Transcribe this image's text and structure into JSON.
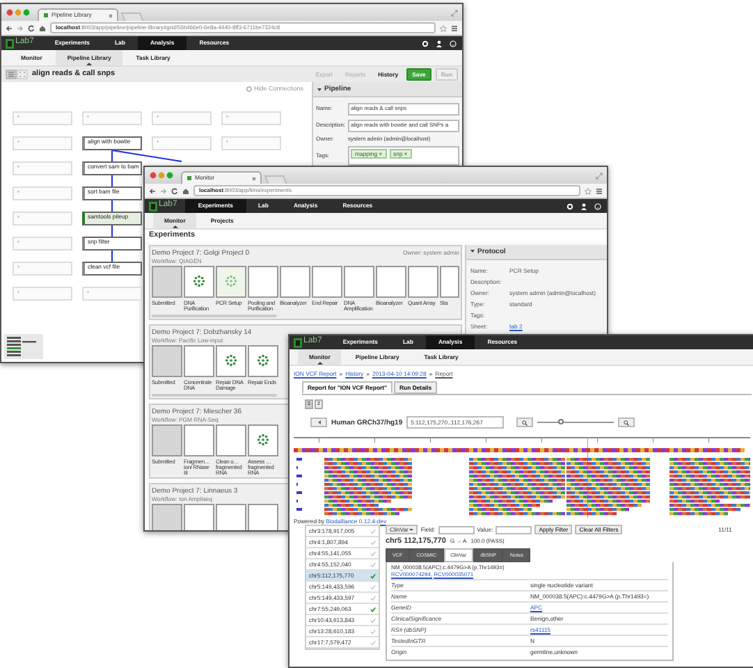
{
  "pipeline_window": {
    "browser_tab": "Pipeline Library",
    "url": "**localhost**:8003/app/pipeline/pipeline-library#grid/55b466e0-6e8a-4440-8ff3-6711be7324c8",
    "logo": "Lab7",
    "nav": [
      {
        "label": "Experiments",
        "selected": false
      },
      {
        "label": "Lab",
        "selected": false
      },
      {
        "label": "Analysis",
        "selected": true
      },
      {
        "label": "Resources",
        "selected": false
      }
    ],
    "subnav": [
      {
        "label": "Monitor",
        "selected": false
      },
      {
        "label": "Pipeline Library",
        "selected": true
      },
      {
        "label": "Task Library",
        "selected": false
      }
    ],
    "title": "align reads & call snps",
    "actions": [
      {
        "label": "Export",
        "kind": "link",
        "disabled": true
      },
      {
        "label": "Reports",
        "kind": "link",
        "disabled": true
      },
      {
        "label": "History",
        "kind": "link",
        "disabled": false
      },
      {
        "label": "Save",
        "kind": "button",
        "disabled": false
      },
      {
        "label": "Run",
        "kind": "button",
        "disabled": true
      }
    ],
    "hide_connections": "Hide Connections",
    "grid_rows": [
      [
        {
          "label": "+",
          "kind": "slot"
        },
        {
          "label": "+",
          "kind": "slot"
        },
        {
          "label": "+",
          "kind": "slot"
        },
        {
          "label": "+",
          "kind": "slot"
        }
      ],
      [
        {
          "label": "+",
          "kind": "slot"
        },
        {
          "label": "align with bowtie",
          "kind": "task",
          "selected": false,
          "connects_down": true,
          "connects_down_right": true
        },
        {
          "label": "+",
          "kind": "slot"
        },
        {
          "label": "+",
          "kind": "slot"
        }
      ],
      [
        {
          "label": "+",
          "kind": "slot"
        },
        {
          "label": "convert sam to bam",
          "kind": "task",
          "selected": false,
          "connects_down": true,
          "connects_down_right": false
        }
      ],
      [
        {
          "label": "+",
          "kind": "slot"
        },
        {
          "label": "sort bam file",
          "kind": "task",
          "selected": false,
          "connects_down": true,
          "connects_down_right": false
        }
      ],
      [
        {
          "label": "+",
          "kind": "slot"
        },
        {
          "label": "samtools pileup",
          "kind": "task",
          "selected": true,
          "connects_down": true,
          "connects_down_right": false
        }
      ],
      [
        {
          "label": "+",
          "kind": "slot"
        },
        {
          "label": "snp filter",
          "kind": "task",
          "selected": false,
          "connects_down": true,
          "connects_down_right": false
        }
      ],
      [
        {
          "label": "+",
          "kind": "slot"
        },
        {
          "label": "clean vcf file",
          "kind": "task",
          "selected": false,
          "connects_down": false,
          "connects_down_right": false
        }
      ],
      [
        {
          "label": "+",
          "kind": "slot"
        },
        {
          "label": "+",
          "kind": "slot"
        }
      ]
    ],
    "panel": {
      "title": "Pipeline",
      "fields": [
        {
          "label": "Name:",
          "value": "align reads & call snps",
          "kind": "input"
        },
        {
          "label": "Description:",
          "value": "align reads with bowtie and call SNPs a",
          "kind": "input"
        },
        {
          "label": "Owner:",
          "value": "system admin (admin@localhost)",
          "kind": "text"
        },
        {
          "label": "Tags:",
          "tags": [
            {
              "label": "mapping",
              "remove": "×"
            },
            {
              "label": "snp",
              "remove": "×"
            }
          ],
          "kind": "tags"
        }
      ]
    }
  },
  "monitor_window": {
    "browser_tab": "Monitor",
    "url": "**localhost**:8003/app/lims/experiments",
    "logo": "Lab7",
    "nav": [
      {
        "label": "Experiments",
        "selected": true
      },
      {
        "label": "Lab",
        "selected": false
      },
      {
        "label": "Analysis",
        "selected": false
      },
      {
        "label": "Resources",
        "selected": false
      }
    ],
    "subnav": [
      {
        "label": "Monitor",
        "selected": true
      },
      {
        "label": "Projects",
        "selected": false
      }
    ],
    "heading": "Experiments",
    "projects": [
      {
        "name": "Demo Project 7: Golgi Project 0",
        "workflow": "Workflow: QIAGEN",
        "owner": "Owner: system admin",
        "steps": [
          {
            "label": "Submitted",
            "kind": "submitted",
            "selected": false
          },
          {
            "label": "DNA Purification",
            "kind": "samples",
            "selected": false
          },
          {
            "label": "PCR Setup",
            "kind": "samples",
            "selected": true
          },
          {
            "label": "Pooling and Purification",
            "kind": "empty",
            "selected": false
          },
          {
            "label": "Bioanalyzer",
            "kind": "empty",
            "selected": false
          },
          {
            "label": "End Repair",
            "kind": "empty",
            "selected": false
          },
          {
            "label": "DNA Amplification",
            "kind": "empty",
            "selected": false
          },
          {
            "label": "Bioanalyzer",
            "kind": "empty",
            "selected": false
          },
          {
            "label": "Quant Array",
            "kind": "empty",
            "selected": false
          },
          {
            "label": "Sta",
            "kind": "empty",
            "selected": false
          }
        ]
      },
      {
        "name": "Demo Project 7: Dobzhansky 14",
        "workflow": "Workflow: Pacific Low-input",
        "steps": [
          {
            "label": "Submitted",
            "kind": "submitted",
            "selected": false
          },
          {
            "label": "Concentrate DNA",
            "kind": "empty",
            "selected": false
          },
          {
            "label": "Repair DNA Damage",
            "kind": "samples",
            "selected": false
          },
          {
            "label": "Repair Ends",
            "kind": "samples",
            "selected": false
          }
        ]
      },
      {
        "name": "Demo Project 7: Miescher 36",
        "workflow": "Workflow: PGM RNA-Seq",
        "steps": [
          {
            "label": "Submitted",
            "kind": "submitted",
            "selected": false
          },
          {
            "label": "Fragmen…ion/ RNase III",
            "kind": "empty",
            "selected": false
          },
          {
            "label": "Clean u… fragmented RNA",
            "kind": "empty",
            "selected": false
          },
          {
            "label": "Assess … fragmented RNA",
            "kind": "samples",
            "selected": false
          }
        ]
      },
      {
        "name": "Demo Project 7: Linnaeus 3",
        "workflow": "Workflow: Ion Ampliseq",
        "steps": [
          {
            "kind": "submitted",
            "selected": false
          },
          {
            "kind": "empty",
            "selected": false
          },
          {
            "kind": "empty",
            "selected": false
          },
          {
            "kind": "empty",
            "selected": false
          }
        ]
      }
    ],
    "panel": {
      "title": "Protocol",
      "fields": [
        {
          "label": "Name:",
          "value": "PCR Setup",
          "kind": "text"
        },
        {
          "label": "Description:",
          "kind": "text"
        },
        {
          "label": "Owner:",
          "value": "system admin (admin@localhost)",
          "kind": "text"
        },
        {
          "label": "Type:",
          "value": "standard",
          "kind": "text"
        },
        {
          "label": "Tags:",
          "kind": "text"
        },
        {
          "label": "Sheet:",
          "value": "tab 2",
          "kind": "link"
        }
      ]
    }
  },
  "report_window": {
    "logo": "Lab7",
    "nav": [
      {
        "label": "Experiments",
        "selected": false
      },
      {
        "label": "Lab",
        "selected": false
      },
      {
        "label": "Analysis",
        "selected": true
      },
      {
        "label": "Resources",
        "selected": false
      }
    ],
    "subnav": [
      {
        "label": "Monitor",
        "selected": true
      },
      {
        "label": "Pipeline Library",
        "selected": false
      },
      {
        "label": "Task Library",
        "selected": false
      }
    ],
    "breadcrumb": {
      "separator": "»",
      "items": [
        "ION VCF Report",
        "History",
        "2013-04-10 14:09:28",
        "Report"
      ]
    },
    "tabs": [
      {
        "label": "Report for \"ION VCF Report\"",
        "selected": true
      },
      {
        "label": "Run Details",
        "selected": false
      }
    ],
    "pages": [
      {
        "label": "1",
        "selected": true
      },
      {
        "label": "2",
        "selected": false
      }
    ],
    "genome": "Human GRCh37/hg19",
    "location": "5:112,175,270..112,176,267",
    "zoom": {
      "level": 0.3
    },
    "powered_by": {
      "text": "Powered by",
      "link": "Biodalliance 0.12.4-dev"
    },
    "count": "11/11",
    "variants": [
      {
        "label": "chr3:178,917,005",
        "selected": false,
        "confirmed": false
      },
      {
        "label": "chr4:1,807,894",
        "selected": false,
        "confirmed": false
      },
      {
        "label": "chr4:55,141,055",
        "selected": false,
        "confirmed": false
      },
      {
        "label": "chr4:55,152,040",
        "selected": false,
        "confirmed": false
      },
      {
        "label": "chr5:112,175,770",
        "selected": true,
        "confirmed": true
      },
      {
        "label": "chr5:149,433,596",
        "selected": false,
        "confirmed": false
      },
      {
        "label": "chr5:149,433,597",
        "selected": false,
        "confirmed": false
      },
      {
        "label": "chr7:55,249,063",
        "selected": false,
        "confirmed": true
      },
      {
        "label": "chr10:43,613,843",
        "selected": false,
        "confirmed": false
      },
      {
        "label": "chr13:28,610,183",
        "selected": false,
        "confirmed": false
      },
      {
        "label": "chr17:7,579,472",
        "selected": false,
        "confirmed": false
      }
    ],
    "filter": {
      "source": "ClinVar",
      "field_label": "Field:",
      "value_label": "Value:",
      "buttons": [
        "Apply Filter",
        "Clear All Filters"
      ]
    },
    "variant_title": "chr5 112,175,770",
    "variant_change": "G → A",
    "variant_quality": "100.0 (PASS)",
    "detail_tabs": [
      {
        "label": "VCF",
        "selected": false
      },
      {
        "label": "COSMIC",
        "selected": false
      },
      {
        "label": "ClinVar",
        "selected": true
      },
      {
        "label": "dbSNP",
        "selected": false
      },
      {
        "label": "Notes",
        "selected": false
      }
    ],
    "detail_title": "NM_000038.5(APC):c.4479G>A (p.Thr1493=)",
    "detail_links": [
      "RCV000074294,",
      "RCV000035071"
    ],
    "detail_rows": [
      {
        "key": "Type",
        "value": "single nucleotide variant",
        "kind": "text"
      },
      {
        "key": "Name",
        "value": "NM_000038.5(APC):c.4479G>A (p.Thr1493=)",
        "kind": "text"
      },
      {
        "key": "GeneID",
        "value": "APC",
        "kind": "link"
      },
      {
        "key": "ClinicalSignificance",
        "value": "Benign,other",
        "kind": "text"
      },
      {
        "key": "RS# (dbSNP)",
        "value": "rs41115",
        "kind": "link"
      },
      {
        "key": "TestedInGTR",
        "value": "N",
        "kind": "text"
      },
      {
        "key": "Origin",
        "value": "germline,unknown",
        "kind": "text"
      }
    ]
  }
}
